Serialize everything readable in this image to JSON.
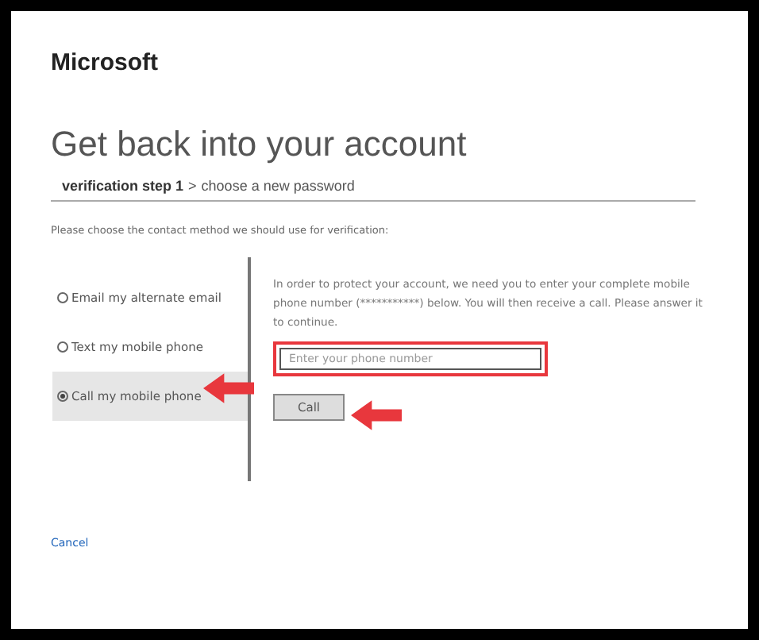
{
  "logo": "Microsoft",
  "title": "Get back into your account",
  "breadcrumb": {
    "current": "verification step 1",
    "separator": ">",
    "next": "choose a new password"
  },
  "instruction": "Please choose the contact method we should use for verification:",
  "methods": [
    {
      "label": "Email my alternate email",
      "selected": false
    },
    {
      "label": "Text my mobile phone",
      "selected": false
    },
    {
      "label": "Call my mobile phone",
      "selected": true
    }
  ],
  "description": "In order to protect your account, we need you to enter your complete mobile phone number (***********) below. You will then receive a call. Please answer it to continue.",
  "phone_field": {
    "placeholder": "Enter your phone number"
  },
  "call_button": "Call",
  "cancel_link": "Cancel"
}
